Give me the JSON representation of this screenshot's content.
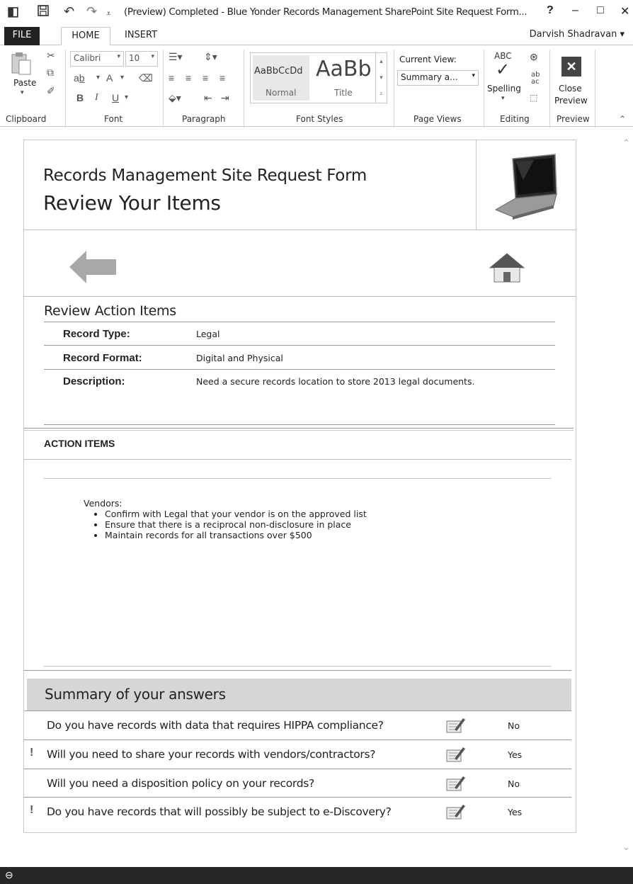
{
  "window": {
    "title": "(Preview) Completed - Blue Yonder Records Management SharePoint Site Request Form...",
    "help": "?",
    "minimize": "–",
    "maximize": "□",
    "close": "✕"
  },
  "tabs": {
    "file": "FILE",
    "home": "HOME",
    "insert": "INSERT"
  },
  "user": {
    "name": "Darvish Shadravan"
  },
  "ribbon": {
    "clipboard": {
      "paste": "Paste",
      "label": "Clipboard"
    },
    "font": {
      "family": "Calibri",
      "size": "10",
      "bold": "B",
      "italic": "I",
      "underline": "U",
      "color_a": "A",
      "label": "Font"
    },
    "paragraph": {
      "label": "Paragraph"
    },
    "styles": {
      "normal_sample": "AaBbCcDd",
      "normal": "Normal",
      "title_sample": "AaBb",
      "title": "Title",
      "label": "Font Styles"
    },
    "page_views": {
      "current_view_label": "Current View:",
      "current_view_value": "Summary a...",
      "label": "Page Views"
    },
    "editing": {
      "spelling_abc": "ABC",
      "spelling": "Spelling",
      "replace_ab": "ab",
      "replace_ac": "ac",
      "label": "Editing"
    },
    "preview": {
      "close_line1": "Close",
      "close_line2": "Preview",
      "label": "Preview"
    }
  },
  "form": {
    "header_line1": "Records Management Site Request Form",
    "header_line2": "Review Your Items",
    "review_title": "Review Action Items",
    "fields": [
      {
        "label": "Record Type:",
        "value": "Legal"
      },
      {
        "label": "Record Format:",
        "value": "Digital and Physical"
      },
      {
        "label": "Description:",
        "value": "Need a secure records location to store 2013 legal documents."
      }
    ],
    "action_items_title": "ACTION ITEMS",
    "vendors_label": "Vendors:",
    "vendor_bullets": [
      "Confirm with Legal that your vendor is on the approved list",
      "Ensure that there is a reciprocal non-disclosure in place",
      "Maintain records for all transactions over $500"
    ],
    "summary_title": "Summary of your answers",
    "questions": [
      {
        "flag": "",
        "text": "Do you have records with data that requires HIPPA compliance?",
        "answer": "No"
      },
      {
        "flag": "!",
        "text": "Will you need to share your records with vendors/contractors?",
        "answer": "Yes"
      },
      {
        "flag": "",
        "text": "Will you need a disposition policy on your records?",
        "answer": "No"
      },
      {
        "flag": "!",
        "text": "Do you have records that will possibly be subject to e-Discovery?",
        "answer": "Yes"
      }
    ]
  },
  "icons": {
    "app": "infopath-icon",
    "save": "save-icon",
    "undo": "undo-icon",
    "redo": "redo-icon",
    "back": "back-arrow-icon",
    "home": "home-icon",
    "laptop": "laptop-icon",
    "edit": "edit-answer-icon"
  },
  "colors": {
    "summary_bar": "#d6d6d6",
    "statusbar": "#262626",
    "file_tab": "#222222"
  }
}
